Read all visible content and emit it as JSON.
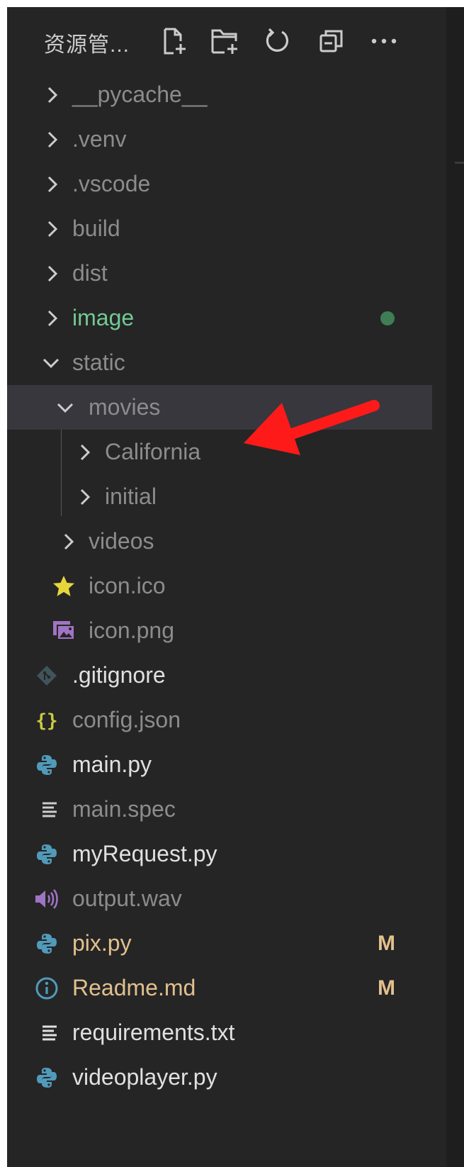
{
  "explorer": {
    "title": "资源管...",
    "actions": [
      {
        "name": "new-file-button",
        "icon": "new-file-icon"
      },
      {
        "name": "new-folder-button",
        "icon": "new-folder-icon"
      },
      {
        "name": "refresh-button",
        "icon": "refresh-icon"
      },
      {
        "name": "collapse-all-button",
        "icon": "collapse-all-icon"
      },
      {
        "name": "more-actions-button",
        "icon": "more-icon"
      }
    ]
  },
  "tree": [
    {
      "label": "__pycache__",
      "type": "folder",
      "expanded": false,
      "status": "ignored"
    },
    {
      "label": ".venv",
      "type": "folder",
      "expanded": false,
      "status": "ignored"
    },
    {
      "label": ".vscode",
      "type": "folder",
      "expanded": false,
      "status": "ignored"
    },
    {
      "label": "build",
      "type": "folder",
      "expanded": false,
      "status": "ignored"
    },
    {
      "label": "dist",
      "type": "folder",
      "expanded": false,
      "status": "ignored"
    },
    {
      "label": "image",
      "type": "folder",
      "expanded": false,
      "status": "untracked",
      "indicator": "dot"
    },
    {
      "label": "static",
      "type": "folder",
      "expanded": true,
      "status": "ignored"
    },
    {
      "label": "movies",
      "type": "folder",
      "expanded": true,
      "status": "ignored",
      "selected": true
    },
    {
      "label": "California",
      "type": "folder",
      "expanded": false,
      "status": "ignored"
    },
    {
      "label": "initial",
      "type": "folder",
      "expanded": false,
      "status": "ignored"
    },
    {
      "label": "videos",
      "type": "folder",
      "expanded": false,
      "status": "ignored"
    },
    {
      "label": "icon.ico",
      "type": "file",
      "icon": "star-icon",
      "status": "ignored"
    },
    {
      "label": "icon.png",
      "type": "file",
      "icon": "image-file-icon",
      "status": "ignored"
    },
    {
      "label": ".gitignore",
      "type": "file",
      "icon": "git-icon",
      "status": "normal"
    },
    {
      "label": "config.json",
      "type": "file",
      "icon": "json-icon",
      "status": "ignored"
    },
    {
      "label": "main.py",
      "type": "file",
      "icon": "python-icon",
      "status": "normal"
    },
    {
      "label": "main.spec",
      "type": "file",
      "icon": "text-lines-icon",
      "status": "ignored"
    },
    {
      "label": "myRequest.py",
      "type": "file",
      "icon": "python-icon",
      "status": "normal"
    },
    {
      "label": "output.wav",
      "type": "file",
      "icon": "audio-icon",
      "status": "ignored"
    },
    {
      "label": "pix.py",
      "type": "file",
      "icon": "python-icon",
      "status": "modified",
      "badge": "M"
    },
    {
      "label": "Readme.md",
      "type": "file",
      "icon": "info-icon",
      "status": "modified",
      "badge": "M"
    },
    {
      "label": "requirements.txt",
      "type": "file",
      "icon": "text-lines-icon",
      "status": "normal"
    },
    {
      "label": "videoplayer.py",
      "type": "file",
      "icon": "python-icon",
      "status": "normal"
    }
  ],
  "colors": {
    "background": "#252526",
    "selected_row": "#37373d",
    "ignored_text": "#8c8c8c",
    "untracked_text": "#73c991",
    "modified_text": "#e2c08d",
    "python_icon": "#519aba",
    "annotation_arrow": "#ff1a1a"
  }
}
